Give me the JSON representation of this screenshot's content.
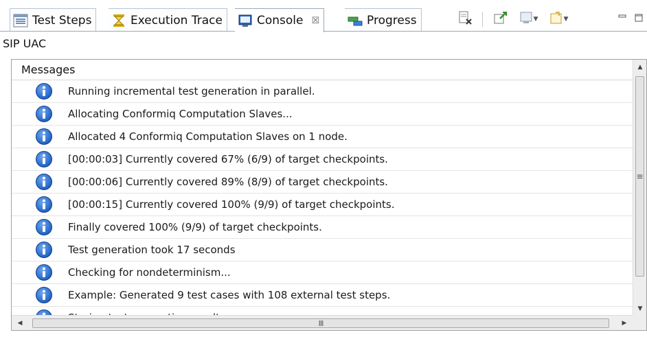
{
  "tabs": [
    {
      "label": "Test Steps",
      "icon": "test-steps-icon"
    },
    {
      "label": "Execution Trace",
      "icon": "execution-trace-icon"
    },
    {
      "label": "Console",
      "icon": "console-icon",
      "active": true,
      "close": "☒"
    },
    {
      "label": "Progress",
      "icon": "progress-icon"
    }
  ],
  "panel_title": "SIP UAC",
  "table": {
    "header": "Messages",
    "rows": [
      "Running incremental test generation in parallel.",
      "Allocating Conformiq Computation Slaves...",
      "Allocated 4 Conformiq Computation Slaves on 1 node.",
      "[00:00:03] Currently covered 67% (6/9) of target checkpoints.",
      "[00:00:06] Currently covered 89% (8/9) of target checkpoints.",
      "[00:00:15] Currently covered 100% (9/9) of target checkpoints.",
      "Finally covered 100% (9/9) of target checkpoints.",
      "Test generation took 17 seconds",
      "Checking for nondeterminism...",
      "Example: Generated 9 test cases with 108 external test steps.",
      "Storing test generation results"
    ],
    "row_icon": "info-icon"
  },
  "scrollbar": {
    "thumb_grip": "≡",
    "h_grip": "III"
  },
  "colors": {
    "info_blue": "#1c5fc4",
    "border": "#9aa8bb"
  }
}
